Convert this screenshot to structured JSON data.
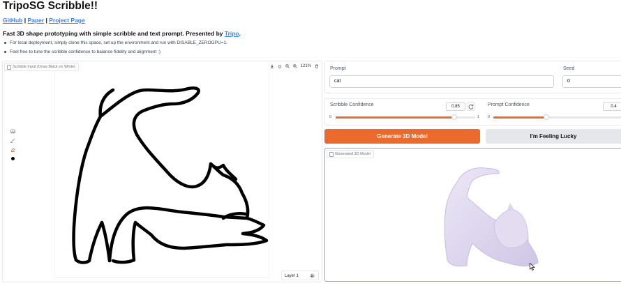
{
  "header": {
    "title": "TripoSG Scribble!!",
    "links": [
      {
        "label": "GitHub"
      },
      {
        "label": "Paper"
      },
      {
        "label": "Project Page"
      }
    ],
    "separator": "|",
    "description": "Fast 3D shape prototyping with simple scribble and text prompt. Presented by ",
    "description_link": "Tripo",
    "description_end": ".",
    "bullets": [
      "For local deployment, simply clone this space, set up the environment and run with DISABLE_ZEROGPU=1.",
      "Feel free to tune the scribble confidence to balance fidelity and alignment :)"
    ]
  },
  "scribble": {
    "label": "Scribble Input (Draw Black on White)",
    "zoom": "121%",
    "layer_label": "Layer 1",
    "brush_color": "#000000",
    "tool_icons": [
      "download-icon",
      "pan-icon",
      "zoom-out-icon",
      "zoom-in-icon",
      "trash-icon"
    ]
  },
  "prompt": {
    "label": "Prompt",
    "value": "cat"
  },
  "seed": {
    "label": "Seed",
    "value": "0"
  },
  "scribble_confidence": {
    "label": "Scribble Confidence",
    "value": "0.85",
    "fraction": 0.85,
    "min": "0",
    "max": "1"
  },
  "prompt_confidence": {
    "label": "Prompt Confidence",
    "value": "0.4",
    "fraction": 0.4,
    "min": "0"
  },
  "buttons": {
    "generate": "Generate 3D Model",
    "lucky": "I'm Feeling Lucky"
  },
  "model_output": {
    "label": "Generated 3D Model"
  },
  "colors": {
    "accent": "#ea6b2d",
    "link": "#3b82f6",
    "model": "#d9d2ec"
  }
}
